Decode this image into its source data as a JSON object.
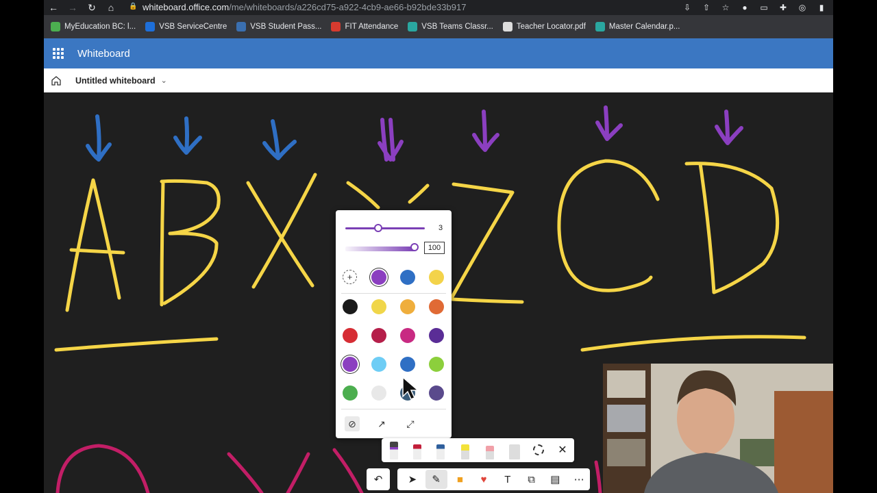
{
  "browser": {
    "url_host": "whiteboard.office.com",
    "url_path": "/me/whiteboards/a226cd75-a922-4cb9-ae66-b92bde33b917"
  },
  "bookmarks": [
    {
      "label": "MyEducation BC: l...",
      "color": "#4caf50"
    },
    {
      "label": "VSB ServiceCentre",
      "color": "#1e6fd9"
    },
    {
      "label": "VSB Student Pass...",
      "color": "#3a6fb0"
    },
    {
      "label": "FIT Attendance",
      "color": "#d63b2f"
    },
    {
      "label": "VSB Teams Classr...",
      "color": "#2aa7a0"
    },
    {
      "label": "Teacher Locator.pdf",
      "color": "#dddddd"
    },
    {
      "label": "Master Calendar.p...",
      "color": "#2aa7a0"
    }
  ],
  "app": {
    "name": "Whiteboard",
    "doc_title": "Untitled whiteboard"
  },
  "ink_panel": {
    "size_value": "3",
    "opacity_value": "100",
    "size_level": 0.4,
    "opacity_level": 1.0,
    "recent_colors": [
      "#8b3fc0",
      "#2f6fc4",
      "#f3d34a"
    ],
    "palette": [
      [
        "#1a1a1a",
        "#f0d64a",
        "#efae3c",
        "#e06a35"
      ],
      [
        "#d62d34",
        "#b51f4a",
        "#c82a82",
        "#5a2d96"
      ],
      [
        "#8b3fc0",
        "#6ecdf5",
        "#2f6fc4",
        "#8ccf3c"
      ],
      [
        "#4cae4f",
        "#e8e8e8",
        "#3a5d7a",
        "#5a4a8c"
      ]
    ],
    "selected_color": "#8b3fc0"
  },
  "colors": {
    "yellow_ink": "#f5d547",
    "blue_ink": "#2f6fc4",
    "purple_ink": "#8b3fc0",
    "magenta_ink": "#c21e66",
    "header_blue": "#3b77c2"
  },
  "toolbar_icons": [
    "undo-icon",
    "select-icon",
    "ink-icon",
    "sticky-note-icon",
    "reaction-icon",
    "text-icon",
    "shapes-icon",
    "templates-icon",
    "more-icon"
  ]
}
